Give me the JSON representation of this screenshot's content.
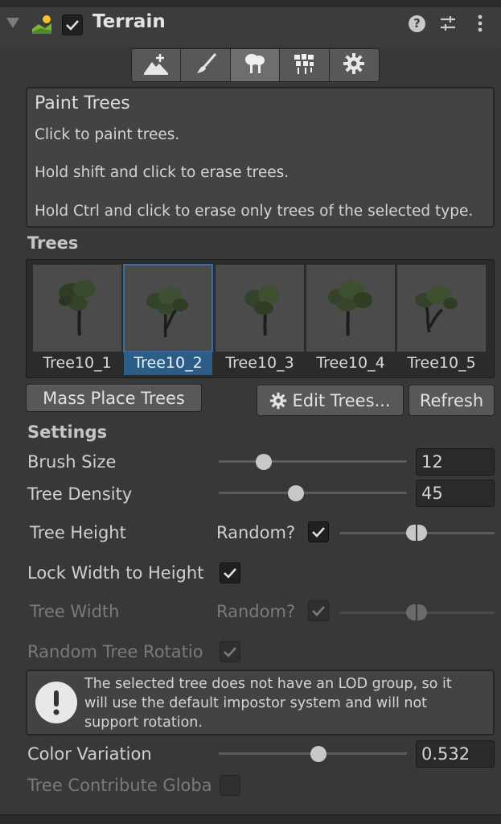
{
  "header": {
    "title": "Terrain",
    "enabled": true,
    "icons": [
      "terrain-icon",
      "help-icon",
      "presets-icon",
      "kebab-menu-icon"
    ]
  },
  "toolbar": {
    "tools": [
      {
        "id": "raise-lower",
        "icon": "mountain-plus-icon"
      },
      {
        "id": "paint-texture",
        "icon": "brush-icon"
      },
      {
        "id": "paint-trees",
        "icon": "trees-icon",
        "active": true
      },
      {
        "id": "paint-details",
        "icon": "details-icon"
      },
      {
        "id": "settings",
        "icon": "gear-icon"
      }
    ]
  },
  "help": {
    "title": "Paint Trees",
    "lines": [
      "Click to paint trees.",
      "Hold shift and click to erase trees.",
      "Hold Ctrl and click to erase only trees of the selected type."
    ]
  },
  "trees": {
    "header": "Trees",
    "items": [
      {
        "label": "Tree10_1",
        "selected": false
      },
      {
        "label": "Tree10_2",
        "selected": true
      },
      {
        "label": "Tree10_3",
        "selected": false
      },
      {
        "label": "Tree10_4",
        "selected": false
      },
      {
        "label": "Tree10_5",
        "selected": false
      }
    ],
    "buttons": {
      "mass_place": "Mass Place Trees",
      "edit": "Edit Trees...",
      "refresh": "Refresh"
    }
  },
  "settings": {
    "header": "Settings",
    "brush_size": {
      "label": "Brush Size",
      "value": "12",
      "fraction": 0.24
    },
    "tree_density": {
      "label": "Tree Density",
      "value": "45",
      "fraction": 0.41
    },
    "tree_height": {
      "label": "Tree Height",
      "random_label": "Random?",
      "random": true
    },
    "lock_width": {
      "label": "Lock Width to Height",
      "checked": true
    },
    "tree_width": {
      "label": "Tree Width",
      "random_label": "Random?",
      "random": true,
      "disabled": true
    },
    "random_rotation": {
      "label": "Random Tree Rotatio",
      "checked": true,
      "disabled": true
    },
    "warning": {
      "lines": [
        "The selected tree does not have an LOD group, so it",
        "will use the default impostor system and will not",
        "support rotation."
      ]
    },
    "color_variation": {
      "label": "Color Variation",
      "value": "0.532",
      "fraction": 0.532
    },
    "contribute_gi": {
      "label": "Tree Contribute Globa",
      "checked": false,
      "disabled": true
    }
  },
  "colors": {
    "panel": "#383838",
    "selection": "#2c5d87",
    "accent": "#3d6a9f"
  }
}
